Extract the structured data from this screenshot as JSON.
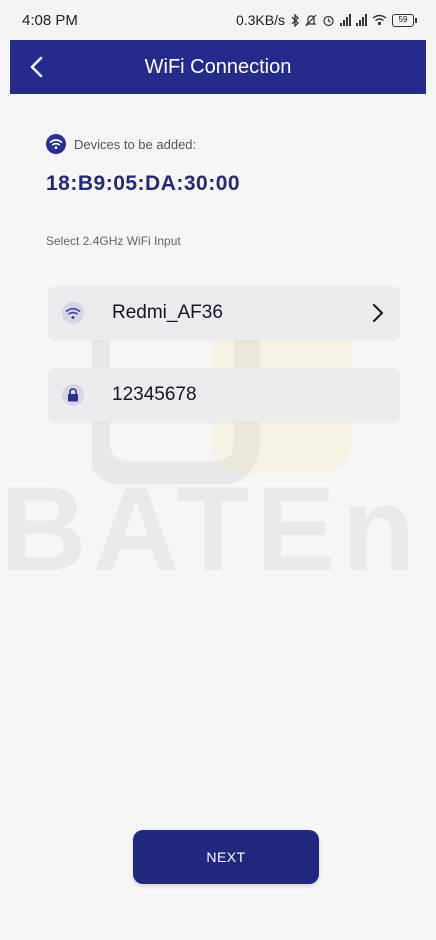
{
  "status_bar": {
    "time": "4:08 PM",
    "network_speed": "0.3KB/s",
    "battery": "59",
    "icons": [
      "bluetooth-icon",
      "mute-icon",
      "alarm-icon",
      "signal-icon",
      "signal-icon",
      "wifi-icon",
      "battery-icon"
    ]
  },
  "app_bar": {
    "title": "WiFi Connection",
    "back_icon": "chevron-left-icon"
  },
  "device": {
    "label": "Devices to be added:",
    "mac": "18:B9:05:DA:30:00"
  },
  "wifi": {
    "hint": "Select 2.4GHz WiFi Input",
    "ssid": "Redmi_AF36",
    "password": "12345678"
  },
  "watermark": {
    "text": "BATEn"
  },
  "actions": {
    "next_label": "NEXT"
  },
  "colors": {
    "primary": "#262a8a",
    "background": "#f6f6f7",
    "field_bg": "#ececee"
  }
}
